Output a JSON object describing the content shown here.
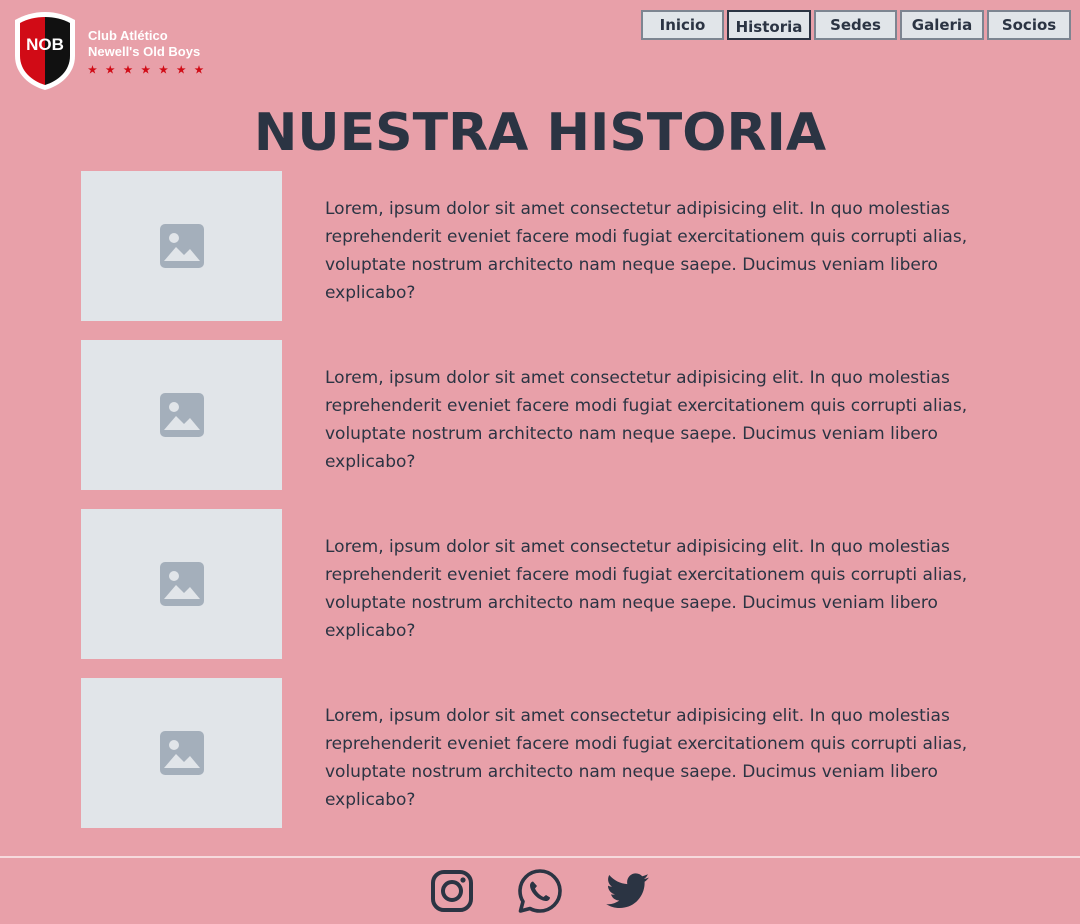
{
  "header": {
    "club_line1": "Club Atlético",
    "club_line2": "Newell's Old Boys",
    "crest_text": "NOB",
    "stars": "★ ★ ★ ★ ★ ★ ★"
  },
  "nav": {
    "items": [
      {
        "label": "Inicio"
      },
      {
        "label": "Historia"
      },
      {
        "label": "Sedes"
      },
      {
        "label": "Galeria"
      },
      {
        "label": "Socios"
      }
    ]
  },
  "main": {
    "title": "NUESTRA HISTORIA",
    "stories": [
      {
        "text": "Lorem, ipsum dolor sit amet consectetur adipisicing elit. In quo molestias reprehenderit eveniet facere modi fugiat exercitationem quis corrupti alias, voluptate nostrum architecto nam neque saepe. Ducimus veniam libero explicabo?",
        "icon": "image-placeholder-icon"
      },
      {
        "text": "Lorem, ipsum dolor sit amet consectetur adipisicing elit. In quo molestias reprehenderit eveniet facere modi fugiat exercitationem quis corrupti alias, voluptate nostrum architecto nam neque saepe. Ducimus veniam libero explicabo?",
        "icon": "image-placeholder-icon"
      },
      {
        "text": "Lorem, ipsum dolor sit amet consectetur adipisicing elit. In quo molestias reprehenderit eveniet facere modi fugiat exercitationem quis corrupti alias, voluptate nostrum architecto nam neque saepe. Ducimus veniam libero explicabo?",
        "icon": "image-placeholder-icon"
      },
      {
        "text": "Lorem, ipsum dolor sit amet consectetur adipisicing elit. In quo molestias reprehenderit eveniet facere modi fugiat exercitationem quis corrupti alias, voluptate nostrum architecto nam neque saepe. Ducimus veniam libero explicabo?",
        "icon": "image-placeholder-icon"
      }
    ]
  },
  "footer": {
    "icons": [
      "instagram-icon",
      "whatsapp-icon",
      "twitter-icon"
    ]
  },
  "colors": {
    "background": "#e8a0a9",
    "text": "#2b3443",
    "button_bg": "#e1e5e9",
    "placeholder": "#e1e5e9",
    "placeholder_icon": "#a4afbb",
    "crest_red": "#d10b16",
    "crest_black": "#111111"
  }
}
